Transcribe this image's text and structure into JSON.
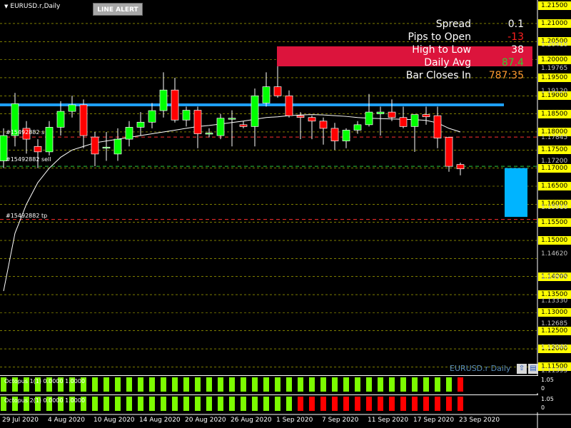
{
  "window": {
    "symbol_title": "EURUSD.r,Daily",
    "line_alert_label": "LINE ALERT"
  },
  "info_panel": [
    {
      "label": "Spread",
      "value": "0.1",
      "color": "#ffffff"
    },
    {
      "label": "Pips to Open",
      "value": "-13",
      "color": "#ff2020"
    },
    {
      "label": "High to Low",
      "value": "38",
      "color": "#ffffff"
    },
    {
      "label": "Daily Avg",
      "value": "87.4",
      "color": "#32cd32"
    },
    {
      "label": "Bar Closes In",
      "value": "787:35",
      "color": "#ff9b30"
    }
  ],
  "price_axis": {
    "grid_levels": [
      1.21,
      1.205,
      1.2,
      1.195,
      1.19,
      1.185,
      1.18,
      1.175,
      1.17,
      1.165,
      1.16,
      1.155,
      1.15,
      1.145,
      1.14,
      1.135,
      1.13,
      1.125,
      1.12,
      1.115
    ],
    "highlighted_labels": [
      "1.21500",
      "1.21000",
      "1.20500",
      "1.20000",
      "1.19500",
      "1.19000",
      "1.18500",
      "1.18000",
      "1.17500",
      "1.17000",
      "1.16500",
      "1.16000",
      "1.15500",
      "1.15000",
      "1.14000",
      "1.13500",
      "1.13000",
      "1.12500",
      "1.12000",
      "1.11500"
    ],
    "extra_ticks": [
      "1.20410",
      "1.19765",
      "1.19120",
      "1.17845",
      "1.17200",
      "1.15910",
      "1.14620",
      "1.13975",
      "1.13330",
      "1.12685",
      "1.12040",
      "1.11395"
    ]
  },
  "orders": {
    "entry_label": "#15492882 s",
    "sell_label": "#15492882 sell",
    "tp_label": "#15492882 tp"
  },
  "chart_data": {
    "type": "candlestick",
    "symbol": "EURUSD.r",
    "timeframe": "Daily",
    "ylim": [
      1.1135,
      1.2165
    ],
    "candles": [
      {
        "o": 1.172,
        "h": 1.181,
        "l": 1.17,
        "c": 1.179
      },
      {
        "o": 1.179,
        "h": 1.1908,
        "l": 1.176,
        "c": 1.1878
      },
      {
        "o": 1.181,
        "h": 1.183,
        "l": 1.174,
        "c": 1.178
      },
      {
        "o": 1.176,
        "h": 1.178,
        "l": 1.17,
        "c": 1.1745
      },
      {
        "o": 1.1745,
        "h": 1.183,
        "l": 1.1735,
        "c": 1.1813
      },
      {
        "o": 1.1813,
        "h": 1.1885,
        "l": 1.179,
        "c": 1.1857
      },
      {
        "o": 1.1857,
        "h": 1.19,
        "l": 1.184,
        "c": 1.1875
      },
      {
        "o": 1.1875,
        "h": 1.189,
        "l": 1.1755,
        "c": 1.179
      },
      {
        "o": 1.1786,
        "h": 1.18,
        "l": 1.1705,
        "c": 1.1739
      },
      {
        "o": 1.1758,
        "h": 1.18,
        "l": 1.172,
        "c": 1.1758
      },
      {
        "o": 1.1739,
        "h": 1.181,
        "l": 1.172,
        "c": 1.178
      },
      {
        "o": 1.178,
        "h": 1.183,
        "l": 1.176,
        "c": 1.1813
      },
      {
        "o": 1.1813,
        "h": 1.1855,
        "l": 1.179,
        "c": 1.1827
      },
      {
        "o": 1.1827,
        "h": 1.188,
        "l": 1.181,
        "c": 1.1859
      },
      {
        "o": 1.1859,
        "h": 1.1965,
        "l": 1.184,
        "c": 1.1916
      },
      {
        "o": 1.1916,
        "h": 1.195,
        "l": 1.1826,
        "c": 1.1833
      },
      {
        "o": 1.1833,
        "h": 1.187,
        "l": 1.1815,
        "c": 1.186
      },
      {
        "o": 1.186,
        "h": 1.187,
        "l": 1.1755,
        "c": 1.1795
      },
      {
        "o": 1.1795,
        "h": 1.181,
        "l": 1.1785,
        "c": 1.1797
      },
      {
        "o": 1.179,
        "h": 1.185,
        "l": 1.178,
        "c": 1.1838
      },
      {
        "o": 1.1838,
        "h": 1.186,
        "l": 1.176,
        "c": 1.1838
      },
      {
        "o": 1.182,
        "h": 1.183,
        "l": 1.181,
        "c": 1.1815
      },
      {
        "o": 1.1815,
        "h": 1.192,
        "l": 1.176,
        "c": 1.19
      },
      {
        "o": 1.188,
        "h": 1.1965,
        "l": 1.187,
        "c": 1.1925
      },
      {
        "o": 1.1925,
        "h": 1.2011,
        "l": 1.1895,
        "c": 1.19
      },
      {
        "o": 1.19,
        "h": 1.1915,
        "l": 1.184,
        "c": 1.1845
      },
      {
        "o": 1.1845,
        "h": 1.1855,
        "l": 1.178,
        "c": 1.184
      },
      {
        "o": 1.184,
        "h": 1.1845,
        "l": 1.178,
        "c": 1.183
      },
      {
        "o": 1.183,
        "h": 1.184,
        "l": 1.1765,
        "c": 1.181
      },
      {
        "o": 1.181,
        "h": 1.1825,
        "l": 1.175,
        "c": 1.1775
      },
      {
        "o": 1.1775,
        "h": 1.181,
        "l": 1.1755,
        "c": 1.1805
      },
      {
        "o": 1.1805,
        "h": 1.183,
        "l": 1.1795,
        "c": 1.182
      },
      {
        "o": 1.182,
        "h": 1.1905,
        "l": 1.1815,
        "c": 1.1855
      },
      {
        "o": 1.185,
        "h": 1.187,
        "l": 1.179,
        "c": 1.1855
      },
      {
        "o": 1.1855,
        "h": 1.189,
        "l": 1.183,
        "c": 1.184
      },
      {
        "o": 1.184,
        "h": 1.187,
        "l": 1.181,
        "c": 1.1815
      },
      {
        "o": 1.1815,
        "h": 1.1845,
        "l": 1.1745,
        "c": 1.1848
      },
      {
        "o": 1.1848,
        "h": 1.187,
        "l": 1.182,
        "c": 1.1842
      },
      {
        "o": 1.1845,
        "h": 1.187,
        "l": 1.1755,
        "c": 1.1783
      },
      {
        "o": 1.1785,
        "h": 1.1787,
        "l": 1.169,
        "c": 1.1705
      },
      {
        "o": 1.171,
        "h": 1.1715,
        "l": 1.168,
        "c": 1.1698
      }
    ],
    "moving_average": [
      1.136,
      1.152,
      1.16,
      1.166,
      1.17,
      1.173,
      1.175,
      1.176,
      1.177,
      1.1775,
      1.178,
      1.1785,
      1.179,
      1.1795,
      1.18,
      1.1805,
      1.181,
      1.1815,
      1.1818,
      1.1822,
      1.1826,
      1.183,
      1.1835,
      1.184,
      1.1842,
      1.1845,
      1.1847,
      1.1848,
      1.1847,
      1.1845,
      1.1843,
      1.184,
      1.1838,
      1.1837,
      1.1836,
      1.1835,
      1.1834,
      1.1832,
      1.1825,
      1.181,
      1.18
    ],
    "levels": [
      {
        "name": "blue-resistance",
        "price": 1.1875,
        "color": "#1ea0ff"
      },
      {
        "name": "red-dashed",
        "price": 1.1786,
        "color": "#ff3030"
      },
      {
        "name": "green-dashed",
        "price": 1.1705,
        "color": "#2ecc40"
      },
      {
        "name": "take-profit",
        "price": 1.1558,
        "color": "#ff3030"
      }
    ],
    "x_labels": [
      "29 Jul 2020",
      "4 Aug 2020",
      "10 Aug 2020",
      "14 Aug 2020",
      "20 Aug 2020",
      "26 Aug 2020",
      "1 Sep 2020",
      "7 Sep 2020",
      "11 Sep 2020",
      "17 Sep 2020",
      "23 Sep 2020"
    ],
    "x_label_index": [
      0,
      4,
      8,
      12,
      16,
      20,
      24,
      28,
      32,
      36,
      40
    ]
  },
  "indicator_1": {
    "label": "Octopus 1(1) 0.0000 1.0000",
    "scale_top": "1.05",
    "scale_bottom": "0",
    "bars": [
      "g",
      "g",
      "g",
      "g",
      "g",
      "g",
      "g",
      "g",
      "g",
      "g",
      "g",
      "g",
      "g",
      "g",
      "g",
      "g",
      "g",
      "g",
      "g",
      "g",
      "g",
      "g",
      "g",
      "g",
      "g",
      "g",
      "g",
      "g",
      "g",
      "g",
      "g",
      "g",
      "g",
      "g",
      "g",
      "g",
      "g",
      "g",
      "g",
      "g",
      "r"
    ]
  },
  "indicator_2": {
    "label": "Octopus 2(1) 0.0000 1.0000",
    "scale_top": "1.05",
    "scale_bottom": "0",
    "bars": [
      "g",
      "g",
      "g",
      "g",
      "g",
      "g",
      "g",
      "g",
      "g",
      "g",
      "g",
      "g",
      "g",
      "g",
      "g",
      "g",
      "g",
      "g",
      "g",
      "g",
      "g",
      "g",
      "g",
      "g",
      "g",
      "g",
      "r",
      "r",
      "r",
      "r",
      "r",
      "r",
      "r",
      "r",
      "r",
      "r",
      "r",
      "r",
      "r",
      "r",
      "r"
    ]
  },
  "footer": {
    "symbol_text": "EURUSD.r Daily"
  },
  "colors": {
    "bull": "#00ff00",
    "bear": "#ff0000",
    "grid": "#c8c800",
    "axis_highlight": "#ffff00"
  }
}
